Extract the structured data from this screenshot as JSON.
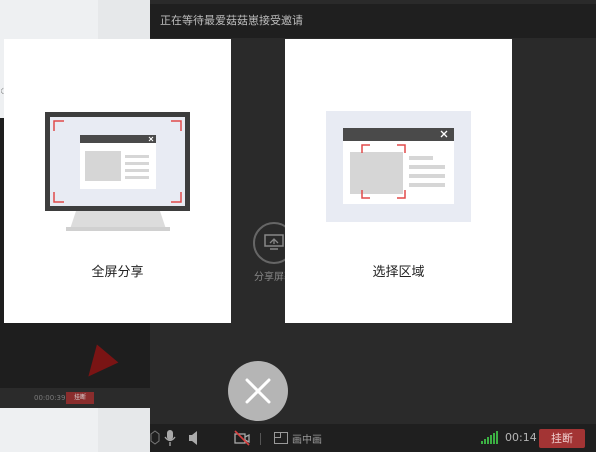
{
  "background": {
    "edge_text": "ঃ",
    "mini_time": "00:00:39",
    "mini_hangup": "挂断"
  },
  "call": {
    "title": "正在等待最爱菇菇崽接受邀请",
    "center_share_label": "分享屏幕",
    "bottom_bar": {
      "pip_label": "画中画",
      "timer": "00:14",
      "hangup_label": "挂断"
    }
  },
  "dialog": {
    "options": [
      {
        "label": "全屏分享",
        "icon": "monitor-icon"
      },
      {
        "label": "选择区域",
        "icon": "region-select-icon"
      }
    ],
    "close_icon": "close-icon"
  },
  "colors": {
    "hangup": "#a33434",
    "corner_marks": "#e04a4a",
    "signal": "#3cb043"
  }
}
